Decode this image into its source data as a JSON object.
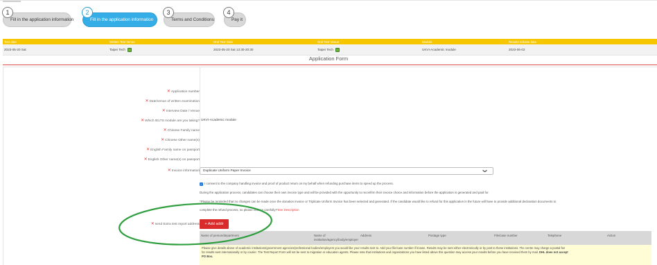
{
  "steps": [
    {
      "number": "1",
      "label": "Fill in the application information"
    },
    {
      "number": "2",
      "label": "Fill in the application information"
    },
    {
      "number": "3",
      "label": "Terms and Conditions"
    },
    {
      "number": "4",
      "label": "Pay it"
    }
  ],
  "exam_table": {
    "headers": [
      "Test date",
      "Written Test Venue",
      "Oral Test Date",
      "Oral Test Venue",
      "Module",
      "Results release date"
    ],
    "row": [
      "2023-05-20 Sat",
      "Taipei Tech",
      "2023-05-20 Sat 13:30-20:30",
      "Taipei Tech",
      "UKVI-Academic module",
      "2023-06-02"
    ]
  },
  "form_title": "Application Form",
  "fields": [
    {
      "label": "Application number",
      "required": "✕",
      "value": ""
    },
    {
      "label": "Date/venue of written examination",
      "required": "✕",
      "value": ""
    },
    {
      "label": "Interview Date / Venue",
      "required": "✕",
      "value": ""
    },
    {
      "label": "Which IELTS module are you taking?",
      "required": "✕",
      "value": "UKVI-Academic module"
    },
    {
      "label": "Chinese Family name",
      "required": "✕",
      "value": ""
    },
    {
      "label": "Chinese Other name(s)",
      "required": "✕",
      "value": ""
    },
    {
      "label": "English Family name on passport",
      "required": "✕",
      "value": ""
    },
    {
      "label": "English Other name(s) on passport",
      "required": "✕",
      "value": ""
    }
  ],
  "invoice": {
    "required": "✕",
    "label": "Invoice information",
    "selected": "Duplicate Uniform Paper Invoice",
    "chevron": "❯"
  },
  "consent_text": "I consent to the company handling invoice and proof of product return on my behalf when refunding purchase items to speed up the process.",
  "process_text": "During the application process, candidates can choose their own invoice type and will be provided with the opportunity to reconfirm their invoice choice and information before the application is generated and paid for.",
  "reminder_line1": "*Please be reminded that no changes can be made once the donation invoice or Triplicate Uniform Invoice has been selected and generated. If the candidate would like to refund for this application in the future will have to provide additional declaration documents to",
  "reminder_line2": "complete the refund process, so please choose carefully!",
  "see_description": "*See Description",
  "extra_report": {
    "required": "✕",
    "label": "send Extra test report address",
    "add_button": "+ Add addr",
    "columns": [
      "Name of person/department",
      "Name of institution/agency/body/employer",
      "Address",
      "Postage type",
      "File/case number",
      "Telephone",
      "Action"
    ],
    "notice_line1": "Please give details above of academic institutions/government agencies/professional bodies/employers you would like your results sent to. Add your file/case number if known. Results may be sent either electronically or by post to these institutions. The centre may charge a postal fee",
    "notice_line2": "for results sent internationally or by courier. The Test Report Form will not be sent to migration or education agents. Please note that institutions and organizations you have listed above this question may access your results before you have received them by mail.",
    "notice_bold": "DHL does not accept",
    "notice_line3": "PO Box."
  },
  "colors": {
    "header_yellow": "#f6c700",
    "active_step": "#35aee8",
    "required_red": "#e53935",
    "add_button_red": "#d92b2b",
    "annotation_green": "#2e9e3e"
  }
}
